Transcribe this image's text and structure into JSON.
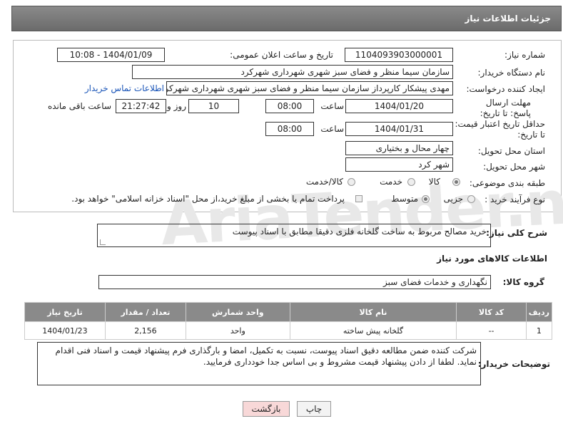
{
  "header": {
    "title": "جزئیات اطلاعات نیاز"
  },
  "form": {
    "need_number_label": "شماره نیاز:",
    "need_number": "1104093903000001",
    "announce_label": "تاریخ و ساعت اعلان عمومی:",
    "announce_value": "1404/01/09 - 10:08",
    "buyer_org_label": "نام دستگاه خریدار:",
    "buyer_org": "سازمان سیما منظر و فضای سبز شهری شهرداری شهرکرد",
    "creator_label": "ایجاد کننده درخواست:",
    "creator": "مهدی پیشکار کارپرداز سازمان سیما منظر و فضای سبز شهری شهرداری شهرکرد",
    "contact_link": "اطلاعات تماس خریدار",
    "deadline_label": "مهلت ارسال پاسخ: تا تاریخ:",
    "deadline_date": "1404/01/20",
    "time_label": "ساعت",
    "deadline_time": "08:00",
    "days_value": "10",
    "days_label": "روز و",
    "remaining_time": "21:27:42",
    "remaining_label": "ساعت باقی مانده",
    "validity_label": "حداقل تاریخ اعتبار قیمت: تا تاریخ:",
    "validity_date": "1404/01/31",
    "validity_time": "08:00",
    "province_label": "استان محل تحویل:",
    "province": "چهار محال و بختیاری",
    "city_label": "شهر محل تحویل:",
    "city": "شهر کرد",
    "category_label": "طبقه بندی موضوعی:",
    "category_options": [
      "کالا",
      "خدمت",
      "کالا/خدمت"
    ],
    "process_label": "نوع فرآیند خرید :",
    "process_options": [
      "جزیی",
      "متوسط"
    ],
    "payment_note": "پرداخت تمام یا بخشی از مبلغ خرید،از محل \"اسناد خزانه اسلامی\" خواهد بود."
  },
  "description": {
    "label": "شرح کلی نیاز:",
    "value": "خرید مصالح مربوط به ساخت گلخانه فلزی دقیقا مطابق با اسناد پیوست"
  },
  "goods": {
    "section_title": "اطلاعات کالاهای مورد نیاز",
    "group_label": "گروه کالا:",
    "group_value": "نگهداری و خدمات فضای سبز",
    "columns": [
      "ردیف",
      "کد کالا",
      "نام کالا",
      "واحد شمارش",
      "تعداد / مقدار",
      "تاریخ نیاز"
    ],
    "rows": [
      [
        "1",
        "--",
        "گلخانه پیش ساخته",
        "واحد",
        "2,156",
        "1404/01/23"
      ]
    ]
  },
  "buyer_notes": {
    "label": "توضیحات خریدار:",
    "value": "شرکت کننده ضمن مطالعه دقیق اسناد پیوست، نسبت به تکمیل، امضا و بارگذاری فرم پیشنهاد قیمت و اسناد فنی اقدام نماید. لطفا از دادن پیشنهاد قیمت مشروط و بی اساس جدا خودداری فرمایید."
  },
  "buttons": {
    "print": "چاپ",
    "back": "بازگشت"
  },
  "watermark": "AriaTender.net",
  "colors": {
    "header": "#7a7a7a",
    "link": "#1a55b8",
    "back_button": "#f8d8d8"
  }
}
